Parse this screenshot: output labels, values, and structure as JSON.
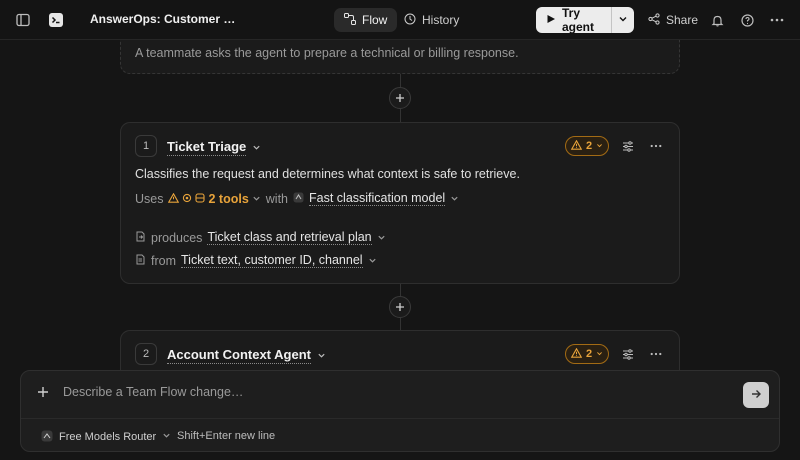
{
  "header": {
    "title": "AnswerOps: Customer …",
    "tabs": [
      {
        "label": "Flow",
        "active": true
      },
      {
        "label": "History",
        "active": false
      }
    ],
    "try_label": "Try agent",
    "share_label": "Share"
  },
  "flow": {
    "trigger_text": "A teammate asks the agent to prepare a technical or billing response.",
    "steps": [
      {
        "number": "1",
        "name": "Ticket Triage",
        "warnings": "2",
        "description": "Classifies the request and determines what context is safe to retrieve.",
        "uses_label": "Uses",
        "tools_label": "2 tools",
        "with_label": "with",
        "model": "Fast classification model",
        "produces_label": "produces",
        "produces_value": "Ticket class and retrieval plan",
        "from_label": "from",
        "from_value": "Ticket text, customer ID, channel"
      },
      {
        "number": "2",
        "name": "Account Context Agent",
        "warnings": "2"
      }
    ]
  },
  "chat": {
    "placeholder": "Describe a Team Flow change…",
    "router_label": "Free Models Router",
    "hint": "Shift+Enter new line"
  },
  "colors": {
    "accent_warning": "#e8a33a",
    "background": "#141414",
    "card": "#1b1b1b"
  }
}
